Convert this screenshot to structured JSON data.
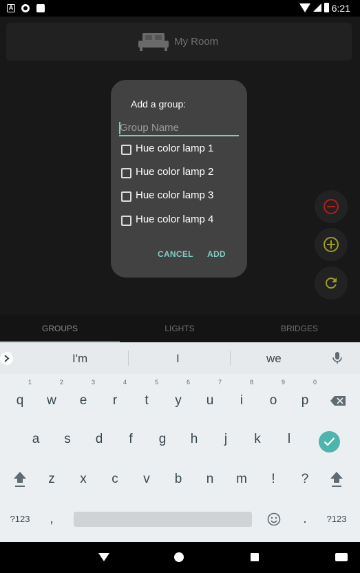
{
  "status_bar": {
    "time": "6:21",
    "icons": [
      "a-notification-icon",
      "circle-notification-icon",
      "sd-card-icon",
      "wifi-icon",
      "signal-icon",
      "battery-icon"
    ]
  },
  "header": {
    "room_name": "My Room",
    "icon": "bed-icon"
  },
  "fabs": [
    {
      "name": "remove",
      "icon": "minus-circle-icon",
      "color": "#b71c1c"
    },
    {
      "name": "add",
      "icon": "plus-circle-icon",
      "color": "#9e9d24"
    },
    {
      "name": "refresh",
      "icon": "refresh-icon",
      "color": "#9e9d24"
    }
  ],
  "tabs": {
    "groups": "GROUPS",
    "lights": "LIGHTS",
    "bridges": "BRIDGES",
    "selected": "groups"
  },
  "dialog": {
    "title": "Add a group:",
    "placeholder": "Group Name",
    "value": "",
    "items": [
      {
        "label": "Hue color lamp 1",
        "checked": false
      },
      {
        "label": "Hue color lamp 2",
        "checked": false
      },
      {
        "label": "Hue color lamp 3",
        "checked": false
      },
      {
        "label": "Hue color lamp 4",
        "checked": false
      }
    ],
    "cancel_label": "CANCEL",
    "add_label": "ADD"
  },
  "keyboard": {
    "suggestions": [
      "I'm",
      "I",
      "we"
    ],
    "row1": [
      {
        "k": "q",
        "h": "1"
      },
      {
        "k": "w",
        "h": "2"
      },
      {
        "k": "e",
        "h": "3"
      },
      {
        "k": "r",
        "h": "4"
      },
      {
        "k": "t",
        "h": "5"
      },
      {
        "k": "y",
        "h": "6"
      },
      {
        "k": "u",
        "h": "7"
      },
      {
        "k": "i",
        "h": "8"
      },
      {
        "k": "o",
        "h": "9"
      },
      {
        "k": "p",
        "h": "0"
      }
    ],
    "row2": [
      "a",
      "s",
      "d",
      "f",
      "g",
      "h",
      "j",
      "k",
      "l"
    ],
    "row3": [
      "z",
      "x",
      "c",
      "v",
      "b",
      "n",
      "m",
      "!",
      "?"
    ],
    "symbols_label": "?123",
    "comma": ",",
    "period": ".",
    "accent": "#4db6ac"
  },
  "nav_bar": {
    "icons": [
      "back-icon",
      "home-icon",
      "recents-icon",
      "keyboard-switch-icon"
    ]
  }
}
